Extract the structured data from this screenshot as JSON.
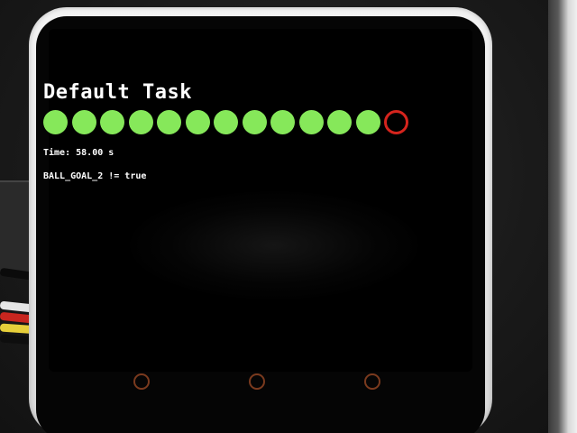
{
  "screen": {
    "title": "Default Task",
    "time_label": "Time:",
    "time_value": "58.00",
    "time_unit": "s",
    "condition": "BALL_GOAL_2 != true"
  },
  "balls": {
    "hit_count": 12,
    "total_visible": 13,
    "states": [
      "hit",
      "hit",
      "hit",
      "hit",
      "hit",
      "hit",
      "hit",
      "hit",
      "hit",
      "hit",
      "hit",
      "hit",
      "miss"
    ]
  },
  "colors": {
    "ball_hit": "#86e85a",
    "ball_miss": "#d5241d",
    "text": "#ffffff",
    "screen_bg": "#000000",
    "case": "#e8e8e8"
  },
  "buttons": [
    "button-a",
    "button-b",
    "button-c"
  ]
}
